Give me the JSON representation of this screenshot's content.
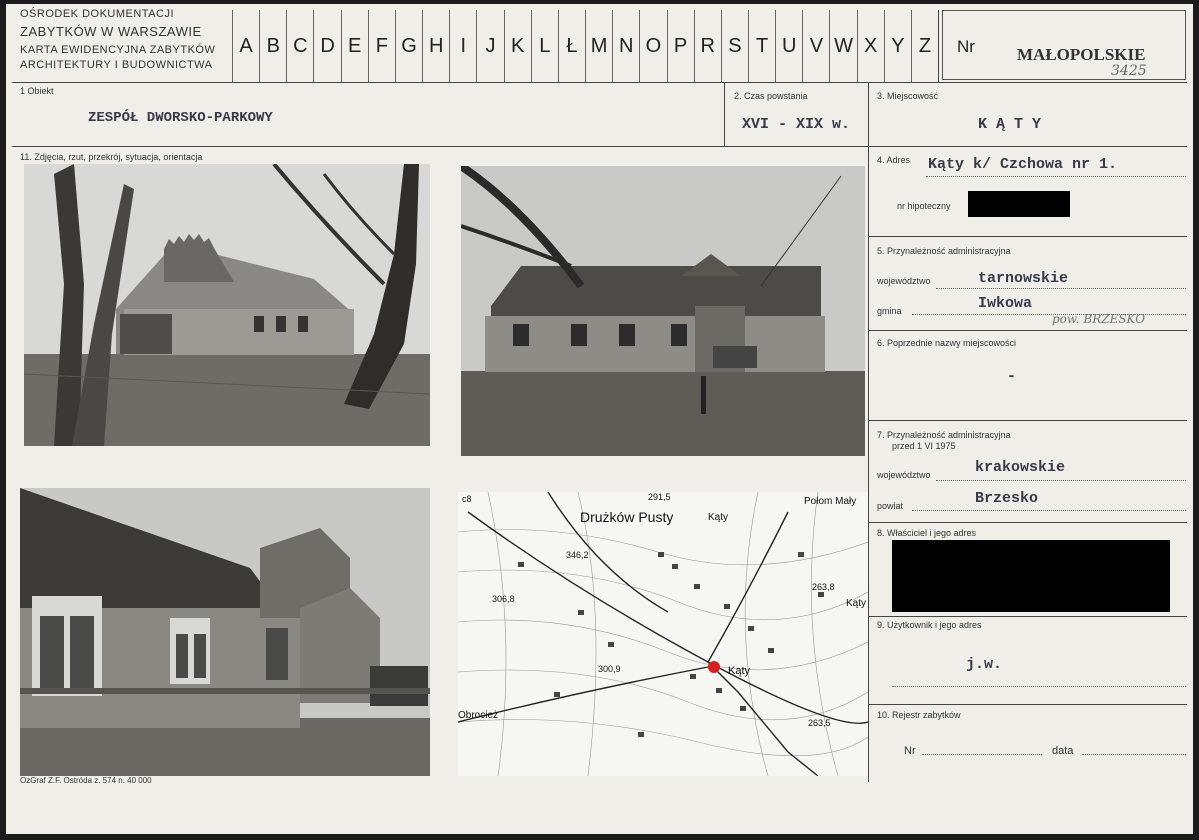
{
  "header": {
    "institution_line1": "OŚRODEK DOKUMENTACJI",
    "institution_line2": "ZABYTKÓW W WARSZAWIE",
    "card_title_line1": "KARTA EWIDENCYJNA ZABYTKÓW",
    "card_title_line2": "ARCHITEKTURY I BUDOWNICTWA",
    "letters": [
      "A",
      "B",
      "C",
      "D",
      "E",
      "F",
      "G",
      "H",
      "I",
      "J",
      "K",
      "L",
      "Ł",
      "M",
      "N",
      "O",
      "P",
      "R",
      "S",
      "T",
      "U",
      "V",
      "W",
      "X",
      "Y",
      "Z"
    ],
    "nr_label": "Nr",
    "region": "MAŁOPOLSKIE",
    "handwritten_number": "3425"
  },
  "fields": {
    "obiekt_label": "1 Obiekt",
    "obiekt_value": "ZESPÓŁ DWORSKO-PARKOWY",
    "czas_label": "2. Czas powstania",
    "czas_value": "XVI - XIX w.",
    "miejscowosc_label": "3. Miejscowość",
    "miejscowosc_value": "K Ą T Y",
    "zdjecia_label": "11. Zdjęcia, rzut, przekrój, sytuacja, orientacja",
    "adres_label": "4. Adres",
    "adres_value": "Kąty k/ Czchowa  nr 1.",
    "hipoteczny_label": "nr hipoteczny",
    "przynaleznosc_label": "5. Przynależność administracyjna",
    "wojewodztwo_label": "województwo",
    "wojewodztwo_value": "tarnowskie",
    "gmina_label": "gmina",
    "gmina_value": "Iwkowa",
    "pow_handwritten": "pow. BRZESKO",
    "poprzednie_label": "6. Poprzednie nazwy miejscowości",
    "poprzednie_value": "-",
    "przed_label_1": "7. Przynależność administracyjna",
    "przed_label_2": "przed 1 VI 1975",
    "woj2_label": "województwo",
    "woj2_value": "krakowskie",
    "powiat_label": "powiat",
    "powiat_value": "Brzesko",
    "wlasciciel_label": "8. Właściciel i jego adres",
    "uzytkownik_label": "9. Użytkownik i jego adres",
    "uzytkownik_value": "j.w.",
    "rejestr_label": "10. Rejestr zabytków",
    "nr_label": "Nr",
    "data_label": "data"
  },
  "map": {
    "labels": [
      "Drużków Pusty",
      "Kąty",
      "Kąty",
      "Kąty",
      "Połom Mały",
      "Obrocież"
    ],
    "heights": [
      "291,5",
      "346,2",
      "306,8",
      "263,8",
      "300,9",
      "263,5"
    ],
    "corner": "c8"
  },
  "footer": {
    "printer": "OzGraf Z.F. Ostróda z. 574 n. 40 000"
  },
  "colors": {
    "paper": "#efeee9",
    "redaction": "#000000",
    "map_marker": "#d42020"
  }
}
